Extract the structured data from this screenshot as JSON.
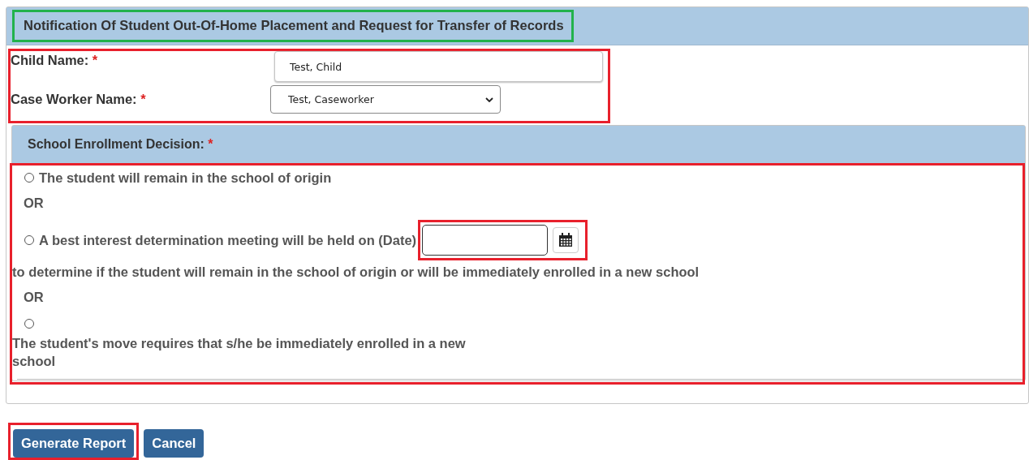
{
  "form": {
    "title": "Notification Of Student Out-Of-Home Placement and Request for Transfer of Records",
    "title_highlighted": true
  },
  "fields": {
    "highlighted": true,
    "items": [
      {
        "kind": "text",
        "label": "Child Name:",
        "required_mark": "*",
        "value": "Test, Child"
      },
      {
        "kind": "select",
        "label": "Case Worker Name:",
        "required_mark": "*",
        "value": "Test, Caseworker"
      }
    ]
  },
  "decision": {
    "heading": "School Enrollment Decision:",
    "required_mark": "*",
    "highlighted": true,
    "options": [
      {
        "kind": "radio",
        "selected": false,
        "label": "The student will remain in the school of origin"
      },
      {
        "kind": "separator",
        "text": "OR"
      },
      {
        "kind": "radio_date",
        "selected": false,
        "label": "A best interest determination meeting will be held on (Date)",
        "date_highlighted": true,
        "continuation": "to determine if the student will remain in the school of origin or will be immediately enrolled in a new school"
      },
      {
        "kind": "separator",
        "text": "OR"
      },
      {
        "kind": "radio_below",
        "selected": false,
        "label": "The student's move requires that s/he be immediately enrolled in a new school"
      }
    ]
  },
  "buttons": [
    {
      "label": "Generate Report",
      "highlighted": true
    },
    {
      "label": "Cancel",
      "highlighted": false
    }
  ]
}
